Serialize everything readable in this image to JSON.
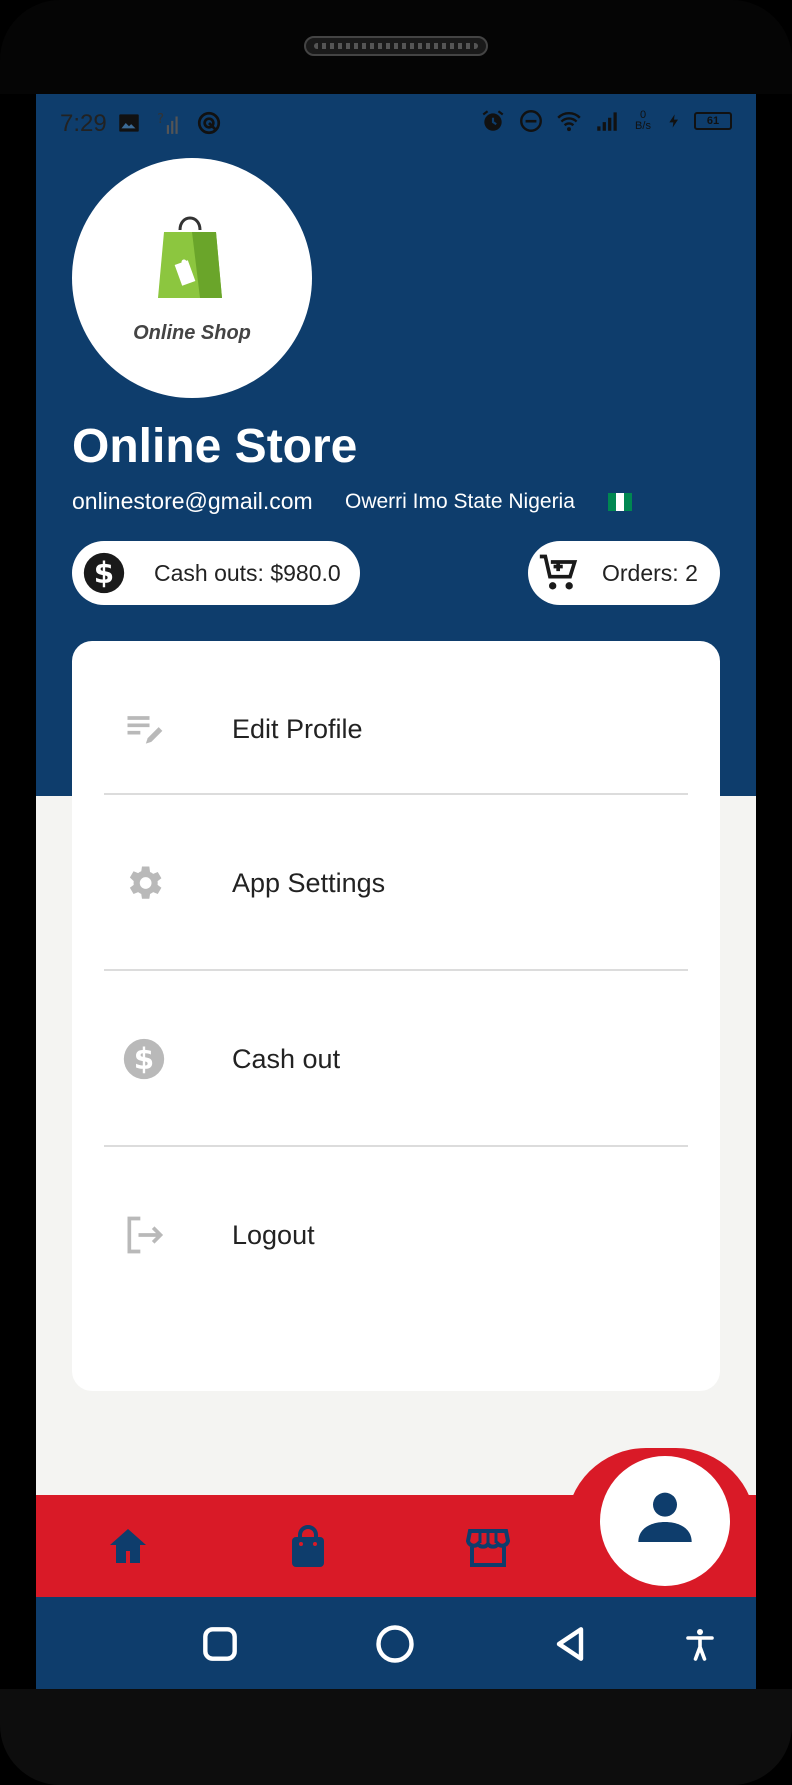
{
  "status_bar": {
    "time": "7:29",
    "left_icons": [
      "image-icon",
      "no-sim-signal-icon",
      "sync-icon"
    ],
    "right_icons": [
      "alarm-icon",
      "do-not-disturb-icon",
      "wifi-icon",
      "signal-icon",
      "data-speed-icon",
      "charging-icon",
      "battery-icon"
    ],
    "data_speed_top": "0",
    "data_speed_bottom": "B/s",
    "battery_level": "61"
  },
  "store": {
    "logo_text": "Online Shop",
    "name": "Online Store",
    "email": "onlinestore@gmail.com",
    "location": "Owerri Imo State Nigeria",
    "flag_colors": [
      "#008751",
      "#ffffff",
      "#008751"
    ]
  },
  "stats": {
    "cash_outs": "Cash outs: $980.0",
    "orders": "Orders: 2"
  },
  "menu": [
    {
      "label": "Edit Profile",
      "icon": "edit-note-icon"
    },
    {
      "label": "App Settings",
      "icon": "gear-icon"
    },
    {
      "label": "Cash out",
      "icon": "dollar-circle-icon"
    },
    {
      "label": "Logout",
      "icon": "logout-icon"
    }
  ],
  "bottom_nav": [
    "home-icon",
    "shopping-bag-icon",
    "storefront-icon",
    "person-icon"
  ],
  "system_nav": [
    "recents-icon",
    "home-circle-icon",
    "back-icon",
    "accessibility-icon"
  ],
  "colors": {
    "header_blue": "#0e3d6c",
    "nav_red": "#d91a27",
    "logo_green": "#8cc63f",
    "icon_grey": "#b9b9b9"
  }
}
